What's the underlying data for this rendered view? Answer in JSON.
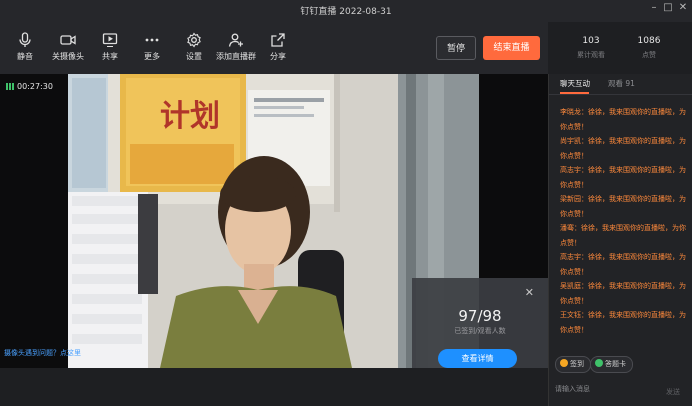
{
  "window": {
    "title": "钉钉直播 2022-08-31"
  },
  "toolbar": {
    "items": [
      {
        "label": "静音",
        "icon": "microphone-icon"
      },
      {
        "label": "关摄像头",
        "icon": "camera-icon"
      },
      {
        "label": "共享",
        "icon": "screen-share-icon"
      },
      {
        "label": "更多",
        "icon": "more-dots-icon"
      },
      {
        "label": "设置",
        "icon": "gear-icon"
      },
      {
        "label": "添加直播群",
        "icon": "add-group-icon"
      },
      {
        "label": "分享",
        "icon": "share-icon"
      }
    ],
    "pause_label": "暂停",
    "end_label": "结束直播"
  },
  "stats": {
    "views": {
      "value": "103",
      "label": "累计观看"
    },
    "likes": {
      "value": "1086",
      "label": "点赞"
    }
  },
  "video": {
    "timer": "00:27:30",
    "camera_hint": "摄像头遇到问题？点这里",
    "poster_text": "计划"
  },
  "overlay": {
    "count": "97/98",
    "label": "已签到/观看人数",
    "button": "查看详情"
  },
  "sidebar": {
    "tab_chat": "聊天互动",
    "tab_viewers": "观看 91",
    "messages": [
      "李晓龙：徐徐，我来围观你的直播啦，为你点赞！",
      "尚宇凯：徐徐，我来围观你的直播啦，为你点赞！",
      "高志宇：徐徐，我来围观你的直播啦，为你点赞！",
      "梁新园：徐徐，我来围观你的直播啦，为你点赞！",
      "潘骞：徐徐，我来围观你的直播啦，为你点赞！",
      "高志宇：徐徐，我来围观你的直播啦，为你点赞！",
      "吴凯庭：徐徐，我来围观你的直播啦，为你点赞！",
      "王文钰：徐徐，我来围观你的直播啦，为你点赞！"
    ],
    "signin_label": "签到",
    "notice_label": "答题卡",
    "input_placeholder": "请输入消息",
    "send_label": "发送"
  },
  "colors": {
    "accent": "#ff6a3d",
    "message": "#ff8a3c",
    "link": "#4aa1ff",
    "primary": "#1e90ff"
  }
}
